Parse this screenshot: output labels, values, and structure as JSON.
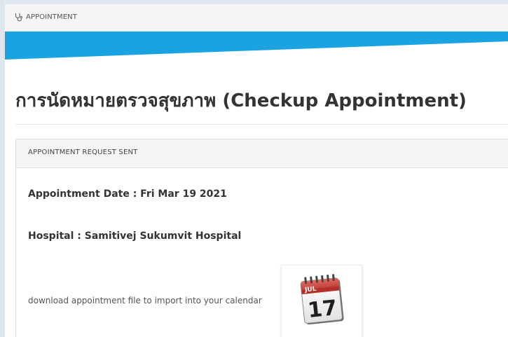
{
  "topbar": {
    "icon": "stethoscope-icon",
    "label": "APPOINTMENT"
  },
  "banner": {
    "color": "#1aa3e0"
  },
  "page": {
    "title": "การนัดหมายตรวจสุขภาพ (Checkup Appointment)"
  },
  "card": {
    "header": "APPOINTMENT REQUEST SENT",
    "date_line": "Appointment Date : Fri Mar 19 2021",
    "hospital_line": "Hospital : Samitivej Sukumvit Hospital",
    "download_text": "download appointment file to import into your calendar",
    "calendar_icon": {
      "name": "calendar-icon",
      "month": "JUL",
      "day": "17"
    }
  }
}
